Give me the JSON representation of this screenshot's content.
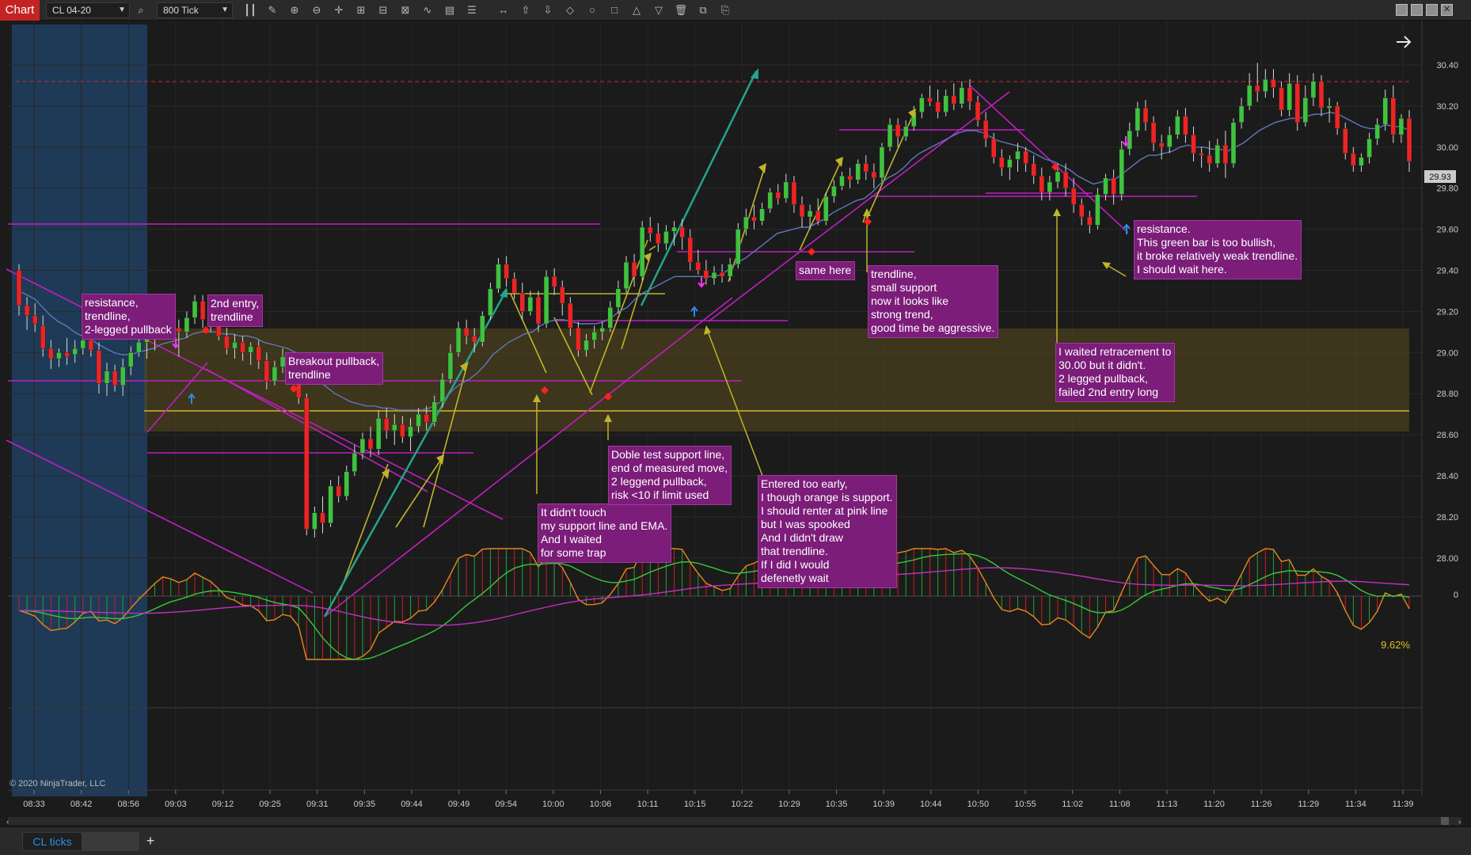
{
  "toolbar": {
    "badge": "Chart",
    "instrument": "CL 04-20",
    "interval": "800 Tick"
  },
  "tabs": {
    "active": "CL ticks",
    "add": "+"
  },
  "chart": {
    "copyright": "© 2020 NinjaTrader, LLC",
    "current_price": "29.93",
    "percent": "9.62%",
    "price_ticks": [
      "30.40",
      "30.20",
      "30.00",
      "29.80",
      "29.60",
      "29.40",
      "29.20",
      "29.00",
      "28.80",
      "28.60",
      "28.40",
      "28.20",
      "28.00"
    ],
    "osc_zero": "0",
    "time_ticks": [
      "08:33",
      "08:42",
      "08:56",
      "09:03",
      "09:12",
      "09:25",
      "09:31",
      "09:35",
      "09:44",
      "09:49",
      "09:54",
      "10:00",
      "10:06",
      "10:11",
      "10:15",
      "10:22",
      "10:29",
      "10:35",
      "10:39",
      "10:44",
      "10:50",
      "10:55",
      "11:02",
      "11:08",
      "11:13",
      "11:20",
      "11:26",
      "11:29",
      "11:34",
      "11:39"
    ]
  },
  "notes": [
    {
      "text": "resistance,\ntrendline,\n2-legged pullback"
    },
    {
      "text": "2nd entry,\ntrendline"
    },
    {
      "text": "Breakout pullback,\ntrendline"
    },
    {
      "text": "It didn't touch\nmy support line and EMA.\nAnd I waited\nfor some trap"
    },
    {
      "text": "Doble test support line,\nend of measured move,\n2 leggend pullback,\nrisk <10 if limit used"
    },
    {
      "text": "Entered too early,\nI though orange is support.\nI should renter at pink line\nbut I was spooked\nAnd I didn't draw\nthat trendline.\nIf I did I would\ndefenetly wait"
    },
    {
      "text": "same here"
    },
    {
      "text": "trendline,\nsmall support\nnow it looks like\nstrong trend,\ngood time be aggressive."
    },
    {
      "text": "I waited retracement to\n30.00 but it didn't.\n2 legged pullback,\nfailed 2nd entry long"
    },
    {
      "text": "resistance.\nThis green bar is too bullish,\nit broke relatively weak trendline.\nI should wait here."
    }
  ],
  "candles": [
    {
      "o": 29.4,
      "h": 29.43,
      "l": 29.18,
      "c": 29.23
    },
    {
      "o": 29.23,
      "h": 29.27,
      "l": 29.11,
      "c": 29.18
    },
    {
      "o": 29.18,
      "h": 29.24,
      "l": 29.1,
      "c": 29.14
    },
    {
      "o": 29.13,
      "h": 29.18,
      "l": 28.98,
      "c": 29.02
    },
    {
      "o": 29.02,
      "h": 29.06,
      "l": 28.92,
      "c": 28.97
    },
    {
      "o": 28.97,
      "h": 29.02,
      "l": 28.93,
      "c": 29.0
    },
    {
      "o": 29.0,
      "h": 29.07,
      "l": 28.94,
      "c": 28.98
    },
    {
      "o": 28.99,
      "h": 29.06,
      "l": 28.95,
      "c": 29.02
    },
    {
      "o": 29.02,
      "h": 29.1,
      "l": 28.99,
      "c": 29.06
    },
    {
      "o": 29.06,
      "h": 29.12,
      "l": 28.98,
      "c": 29.01
    },
    {
      "o": 29.01,
      "h": 29.05,
      "l": 28.8,
      "c": 28.85
    },
    {
      "o": 28.85,
      "h": 28.95,
      "l": 28.79,
      "c": 28.91
    },
    {
      "o": 28.91,
      "h": 28.94,
      "l": 28.81,
      "c": 28.84
    },
    {
      "o": 28.84,
      "h": 28.97,
      "l": 28.79,
      "c": 28.93
    },
    {
      "o": 28.93,
      "h": 29.03,
      "l": 28.89,
      "c": 29.0
    },
    {
      "o": 29.0,
      "h": 29.08,
      "l": 28.98,
      "c": 29.05
    },
    {
      "o": 29.05,
      "h": 29.12,
      "l": 28.97,
      "c": 29.09
    },
    {
      "o": 29.09,
      "h": 29.16,
      "l": 29.01,
      "c": 29.14
    },
    {
      "o": 29.14,
      "h": 29.22,
      "l": 29.1,
      "c": 29.18
    },
    {
      "o": 29.18,
      "h": 29.22,
      "l": 29.1,
      "c": 29.12
    },
    {
      "o": 29.12,
      "h": 29.16,
      "l": 28.98,
      "c": 29.1
    },
    {
      "o": 29.1,
      "h": 29.2,
      "l": 29.07,
      "c": 29.17
    },
    {
      "o": 29.17,
      "h": 29.28,
      "l": 29.14,
      "c": 29.25
    },
    {
      "o": 29.25,
      "h": 29.28,
      "l": 29.12,
      "c": 29.16
    },
    {
      "o": 29.16,
      "h": 29.22,
      "l": 29.1,
      "c": 29.14
    },
    {
      "o": 29.14,
      "h": 29.18,
      "l": 29.06,
      "c": 29.08
    },
    {
      "o": 29.08,
      "h": 29.12,
      "l": 28.99,
      "c": 29.02
    },
    {
      "o": 29.02,
      "h": 29.09,
      "l": 28.97,
      "c": 29.05
    },
    {
      "o": 29.05,
      "h": 29.08,
      "l": 28.96,
      "c": 29.0
    },
    {
      "o": 29.0,
      "h": 29.05,
      "l": 28.94,
      "c": 29.03
    },
    {
      "o": 29.03,
      "h": 29.06,
      "l": 28.92,
      "c": 28.96
    },
    {
      "o": 28.96,
      "h": 29.0,
      "l": 28.82,
      "c": 28.86
    },
    {
      "o": 28.86,
      "h": 28.96,
      "l": 28.84,
      "c": 28.93
    },
    {
      "o": 28.93,
      "h": 29.02,
      "l": 28.9,
      "c": 28.98
    },
    {
      "o": 28.98,
      "h": 29.0,
      "l": 28.87,
      "c": 28.91
    },
    {
      "o": 28.91,
      "h": 28.95,
      "l": 28.75,
      "c": 28.78
    },
    {
      "o": 28.78,
      "h": 28.8,
      "l": 28.11,
      "c": 28.14
    },
    {
      "o": 28.14,
      "h": 28.25,
      "l": 28.1,
      "c": 28.22
    },
    {
      "o": 28.22,
      "h": 28.3,
      "l": 28.12,
      "c": 28.17
    },
    {
      "o": 28.17,
      "h": 28.38,
      "l": 28.15,
      "c": 28.35
    },
    {
      "o": 28.35,
      "h": 28.4,
      "l": 28.27,
      "c": 28.3
    },
    {
      "o": 28.3,
      "h": 28.45,
      "l": 28.28,
      "c": 28.42
    },
    {
      "o": 28.42,
      "h": 28.55,
      "l": 28.4,
      "c": 28.51
    },
    {
      "o": 28.51,
      "h": 28.61,
      "l": 28.48,
      "c": 28.58
    },
    {
      "o": 28.58,
      "h": 28.64,
      "l": 28.49,
      "c": 28.53
    },
    {
      "o": 28.53,
      "h": 28.72,
      "l": 28.5,
      "c": 28.68
    },
    {
      "o": 28.68,
      "h": 28.73,
      "l": 28.58,
      "c": 28.62
    },
    {
      "o": 28.62,
      "h": 28.7,
      "l": 28.55,
      "c": 28.65
    },
    {
      "o": 28.65,
      "h": 28.69,
      "l": 28.56,
      "c": 28.59
    },
    {
      "o": 28.59,
      "h": 28.68,
      "l": 28.52,
      "c": 28.64
    },
    {
      "o": 28.64,
      "h": 28.73,
      "l": 28.61,
      "c": 28.7
    },
    {
      "o": 28.7,
      "h": 28.74,
      "l": 28.62,
      "c": 28.66
    },
    {
      "o": 28.66,
      "h": 28.79,
      "l": 28.64,
      "c": 28.76
    },
    {
      "o": 28.76,
      "h": 28.9,
      "l": 28.73,
      "c": 28.87
    },
    {
      "o": 28.87,
      "h": 29.04,
      "l": 28.85,
      "c": 29.0
    },
    {
      "o": 29.0,
      "h": 29.15,
      "l": 28.98,
      "c": 29.12
    },
    {
      "o": 29.12,
      "h": 29.16,
      "l": 29.04,
      "c": 29.08
    },
    {
      "o": 29.08,
      "h": 29.12,
      "l": 29.0,
      "c": 29.05
    },
    {
      "o": 29.05,
      "h": 29.2,
      "l": 29.03,
      "c": 29.18
    },
    {
      "o": 29.18,
      "h": 29.34,
      "l": 29.16,
      "c": 29.31
    },
    {
      "o": 29.31,
      "h": 29.46,
      "l": 29.29,
      "c": 29.43
    },
    {
      "o": 29.43,
      "h": 29.47,
      "l": 29.32,
      "c": 29.36
    },
    {
      "o": 29.36,
      "h": 29.39,
      "l": 29.26,
      "c": 29.29
    },
    {
      "o": 29.29,
      "h": 29.34,
      "l": 29.16,
      "c": 29.2
    },
    {
      "o": 29.2,
      "h": 29.3,
      "l": 29.18,
      "c": 29.27
    },
    {
      "o": 29.27,
      "h": 29.3,
      "l": 29.1,
      "c": 29.14
    },
    {
      "o": 29.14,
      "h": 29.4,
      "l": 29.12,
      "c": 29.37
    },
    {
      "o": 29.37,
      "h": 29.41,
      "l": 29.28,
      "c": 29.32
    },
    {
      "o": 29.32,
      "h": 29.35,
      "l": 29.18,
      "c": 29.24
    },
    {
      "o": 29.24,
      "h": 29.27,
      "l": 29.08,
      "c": 29.12
    },
    {
      "o": 29.12,
      "h": 29.15,
      "l": 28.98,
      "c": 29.01
    },
    {
      "o": 29.01,
      "h": 29.09,
      "l": 28.98,
      "c": 29.06
    },
    {
      "o": 29.06,
      "h": 29.13,
      "l": 29.02,
      "c": 29.1
    },
    {
      "o": 29.1,
      "h": 29.15,
      "l": 29.06,
      "c": 29.12
    },
    {
      "o": 29.12,
      "h": 29.25,
      "l": 29.1,
      "c": 29.22
    },
    {
      "o": 29.22,
      "h": 29.35,
      "l": 29.19,
      "c": 29.31
    },
    {
      "o": 29.31,
      "h": 29.47,
      "l": 29.29,
      "c": 29.44
    },
    {
      "o": 29.44,
      "h": 29.48,
      "l": 29.32,
      "c": 29.37
    },
    {
      "o": 29.37,
      "h": 29.64,
      "l": 29.35,
      "c": 29.61
    },
    {
      "o": 29.61,
      "h": 29.66,
      "l": 29.54,
      "c": 29.58
    },
    {
      "o": 29.58,
      "h": 29.63,
      "l": 29.49,
      "c": 29.53
    },
    {
      "o": 29.53,
      "h": 29.62,
      "l": 29.5,
      "c": 29.59
    },
    {
      "o": 29.59,
      "h": 29.64,
      "l": 29.52,
      "c": 29.61
    },
    {
      "o": 29.61,
      "h": 29.65,
      "l": 29.5,
      "c": 29.56
    },
    {
      "o": 29.56,
      "h": 29.6,
      "l": 29.4,
      "c": 29.44
    },
    {
      "o": 29.44,
      "h": 29.5,
      "l": 29.38,
      "c": 29.4
    },
    {
      "o": 29.4,
      "h": 29.45,
      "l": 29.33,
      "c": 29.36
    },
    {
      "o": 29.36,
      "h": 29.42,
      "l": 29.33,
      "c": 29.39
    },
    {
      "o": 29.39,
      "h": 29.43,
      "l": 29.34,
      "c": 29.37
    },
    {
      "o": 29.37,
      "h": 29.46,
      "l": 29.35,
      "c": 29.43
    },
    {
      "o": 29.43,
      "h": 29.63,
      "l": 29.41,
      "c": 29.6
    },
    {
      "o": 29.6,
      "h": 29.7,
      "l": 29.57,
      "c": 29.66
    },
    {
      "o": 29.66,
      "h": 29.72,
      "l": 29.6,
      "c": 29.64
    },
    {
      "o": 29.64,
      "h": 29.73,
      "l": 29.62,
      "c": 29.7
    },
    {
      "o": 29.7,
      "h": 29.8,
      "l": 29.68,
      "c": 29.78
    },
    {
      "o": 29.78,
      "h": 29.82,
      "l": 29.72,
      "c": 29.75
    },
    {
      "o": 29.75,
      "h": 29.87,
      "l": 29.73,
      "c": 29.83
    },
    {
      "o": 29.83,
      "h": 29.86,
      "l": 29.68,
      "c": 29.72
    },
    {
      "o": 29.72,
      "h": 29.76,
      "l": 29.61,
      "c": 29.66
    },
    {
      "o": 29.66,
      "h": 29.72,
      "l": 29.6,
      "c": 29.69
    },
    {
      "o": 29.69,
      "h": 29.75,
      "l": 29.62,
      "c": 29.64
    },
    {
      "o": 29.64,
      "h": 29.78,
      "l": 29.62,
      "c": 29.76
    },
    {
      "o": 29.76,
      "h": 29.84,
      "l": 29.73,
      "c": 29.81
    },
    {
      "o": 29.81,
      "h": 29.88,
      "l": 29.79,
      "c": 29.86
    },
    {
      "o": 29.86,
      "h": 29.9,
      "l": 29.8,
      "c": 29.84
    },
    {
      "o": 29.84,
      "h": 29.94,
      "l": 29.82,
      "c": 29.92
    },
    {
      "o": 29.92,
      "h": 29.96,
      "l": 29.84,
      "c": 29.88
    },
    {
      "o": 29.88,
      "h": 29.92,
      "l": 29.8,
      "c": 29.85
    },
    {
      "o": 29.85,
      "h": 30.02,
      "l": 29.83,
      "c": 30.0
    },
    {
      "o": 30.0,
      "h": 30.14,
      "l": 29.98,
      "c": 30.11
    },
    {
      "o": 30.11,
      "h": 30.14,
      "l": 30.0,
      "c": 30.05
    },
    {
      "o": 30.05,
      "h": 30.13,
      "l": 30.03,
      "c": 30.1
    },
    {
      "o": 30.1,
      "h": 30.2,
      "l": 30.08,
      "c": 30.17
    },
    {
      "o": 30.17,
      "h": 30.26,
      "l": 30.14,
      "c": 30.24
    },
    {
      "o": 30.24,
      "h": 30.3,
      "l": 30.2,
      "c": 30.22
    },
    {
      "o": 30.22,
      "h": 30.28,
      "l": 30.14,
      "c": 30.17
    },
    {
      "o": 30.17,
      "h": 30.28,
      "l": 30.15,
      "c": 30.25
    },
    {
      "o": 30.25,
      "h": 30.31,
      "l": 30.18,
      "c": 30.21
    },
    {
      "o": 30.21,
      "h": 30.32,
      "l": 30.19,
      "c": 30.29
    },
    {
      "o": 30.29,
      "h": 30.33,
      "l": 30.18,
      "c": 30.22
    },
    {
      "o": 30.22,
      "h": 30.25,
      "l": 30.1,
      "c": 30.13
    },
    {
      "o": 30.13,
      "h": 30.17,
      "l": 30.0,
      "c": 30.04
    },
    {
      "o": 30.04,
      "h": 30.07,
      "l": 29.92,
      "c": 29.95
    },
    {
      "o": 29.95,
      "h": 29.99,
      "l": 29.86,
      "c": 29.9
    },
    {
      "o": 29.9,
      "h": 29.96,
      "l": 29.84,
      "c": 29.94
    },
    {
      "o": 29.94,
      "h": 30.02,
      "l": 29.88,
      "c": 29.98
    },
    {
      "o": 29.98,
      "h": 30.0,
      "l": 29.88,
      "c": 29.92
    },
    {
      "o": 29.92,
      "h": 29.96,
      "l": 29.82,
      "c": 29.86
    },
    {
      "o": 29.86,
      "h": 29.9,
      "l": 29.74,
      "c": 29.78
    },
    {
      "o": 29.78,
      "h": 29.86,
      "l": 29.74,
      "c": 29.83
    },
    {
      "o": 29.83,
      "h": 29.92,
      "l": 29.8,
      "c": 29.88
    },
    {
      "o": 29.88,
      "h": 29.92,
      "l": 29.76,
      "c": 29.8
    },
    {
      "o": 29.8,
      "h": 29.85,
      "l": 29.68,
      "c": 29.72
    },
    {
      "o": 29.72,
      "h": 29.75,
      "l": 29.62,
      "c": 29.66
    },
    {
      "o": 29.66,
      "h": 29.69,
      "l": 29.58,
      "c": 29.62
    },
    {
      "o": 29.62,
      "h": 29.8,
      "l": 29.6,
      "c": 29.77
    },
    {
      "o": 29.77,
      "h": 29.87,
      "l": 29.74,
      "c": 29.85
    },
    {
      "o": 29.85,
      "h": 29.89,
      "l": 29.72,
      "c": 29.77
    },
    {
      "o": 29.77,
      "h": 30.03,
      "l": 29.74,
      "c": 29.99
    },
    {
      "o": 29.99,
      "h": 30.12,
      "l": 29.96,
      "c": 30.08
    },
    {
      "o": 30.08,
      "h": 30.22,
      "l": 30.05,
      "c": 30.19
    },
    {
      "o": 30.19,
      "h": 30.23,
      "l": 30.08,
      "c": 30.12
    },
    {
      "o": 30.12,
      "h": 30.15,
      "l": 29.98,
      "c": 30.02
    },
    {
      "o": 30.02,
      "h": 30.06,
      "l": 29.94,
      "c": 30.0
    },
    {
      "o": 30.0,
      "h": 30.1,
      "l": 29.97,
      "c": 30.06
    },
    {
      "o": 30.06,
      "h": 30.18,
      "l": 30.04,
      "c": 30.15
    },
    {
      "o": 30.15,
      "h": 30.19,
      "l": 30.02,
      "c": 30.06
    },
    {
      "o": 30.06,
      "h": 30.1,
      "l": 29.93,
      "c": 29.97
    },
    {
      "o": 29.97,
      "h": 30.0,
      "l": 29.9,
      "c": 29.96
    },
    {
      "o": 29.96,
      "h": 30.03,
      "l": 29.88,
      "c": 29.92
    },
    {
      "o": 29.92,
      "h": 30.04,
      "l": 29.9,
      "c": 30.01
    },
    {
      "o": 30.01,
      "h": 30.08,
      "l": 29.85,
      "c": 29.92
    },
    {
      "o": 29.92,
      "h": 30.14,
      "l": 29.9,
      "c": 30.12
    },
    {
      "o": 30.12,
      "h": 30.24,
      "l": 30.09,
      "c": 30.2
    },
    {
      "o": 30.2,
      "h": 30.36,
      "l": 30.18,
      "c": 30.3
    },
    {
      "o": 30.3,
      "h": 30.41,
      "l": 30.22,
      "c": 30.27
    },
    {
      "o": 30.27,
      "h": 30.38,
      "l": 30.24,
      "c": 30.33
    },
    {
      "o": 30.33,
      "h": 30.38,
      "l": 30.24,
      "c": 30.29
    },
    {
      "o": 30.29,
      "h": 30.32,
      "l": 30.15,
      "c": 30.18
    },
    {
      "o": 30.18,
      "h": 30.36,
      "l": 30.15,
      "c": 30.31
    },
    {
      "o": 30.31,
      "h": 30.35,
      "l": 30.08,
      "c": 30.12
    },
    {
      "o": 30.12,
      "h": 30.3,
      "l": 30.1,
      "c": 30.24
    },
    {
      "o": 30.24,
      "h": 30.36,
      "l": 30.2,
      "c": 30.32
    },
    {
      "o": 30.32,
      "h": 30.35,
      "l": 30.15,
      "c": 30.19
    },
    {
      "o": 30.19,
      "h": 30.24,
      "l": 30.12,
      "c": 30.2
    },
    {
      "o": 30.2,
      "h": 30.22,
      "l": 30.06,
      "c": 30.09
    },
    {
      "o": 30.09,
      "h": 30.12,
      "l": 29.94,
      "c": 29.97
    },
    {
      "o": 29.97,
      "h": 30.0,
      "l": 29.88,
      "c": 29.91
    },
    {
      "o": 29.91,
      "h": 29.97,
      "l": 29.88,
      "c": 29.95
    },
    {
      "o": 29.95,
      "h": 30.07,
      "l": 29.92,
      "c": 30.04
    },
    {
      "o": 30.04,
      "h": 30.14,
      "l": 30.01,
      "c": 30.11
    },
    {
      "o": 30.11,
      "h": 30.28,
      "l": 30.08,
      "c": 30.24
    },
    {
      "o": 30.24,
      "h": 30.3,
      "l": 30.02,
      "c": 30.06
    },
    {
      "o": 30.06,
      "h": 30.16,
      "l": 30.02,
      "c": 30.14
    },
    {
      "o": 30.14,
      "h": 30.18,
      "l": 29.88,
      "c": 29.93
    }
  ],
  "ema": [
    29.3,
    29.28,
    29.26,
    29.22,
    29.18,
    29.15,
    29.13,
    29.1,
    29.08,
    29.07,
    29.04,
    29.02,
    29.0,
    28.99,
    28.99,
    29.0,
    29.01,
    29.02,
    29.04,
    29.05,
    29.06,
    29.07,
    29.09,
    29.1,
    29.1,
    29.1,
    29.09,
    29.09,
    29.08,
    29.08,
    29.07,
    29.05,
    29.04,
    29.03,
    29.02,
    29.0,
    28.95,
    28.9,
    28.86,
    28.83,
    28.8,
    28.78,
    28.76,
    28.75,
    28.74,
    28.74,
    28.73,
    28.73,
    28.72,
    28.72,
    28.72,
    28.72,
    28.73,
    28.75,
    28.78,
    28.82,
    28.85,
    28.87,
    28.9,
    28.94,
    28.99,
    29.02,
    29.05,
    29.07,
    29.09,
    29.1,
    29.13,
    29.15,
    29.16,
    29.16,
    29.15,
    29.14,
    29.14,
    29.14,
    29.15,
    29.17,
    29.2,
    29.22,
    29.26,
    29.29,
    29.31,
    29.33,
    29.35,
    29.37,
    29.37,
    29.37,
    29.37,
    29.37,
    29.37,
    29.38,
    29.41,
    29.44,
    29.46,
    29.49,
    29.52,
    29.55,
    29.58,
    29.59,
    29.6,
    29.61,
    29.61,
    29.63,
    29.65,
    29.68,
    29.7,
    29.72,
    29.74,
    29.75,
    29.78,
    29.82,
    29.85,
    29.87,
    29.9,
    29.94,
    29.97,
    29.99,
    30.01,
    30.03,
    30.05,
    30.07,
    30.08,
    30.08,
    30.07,
    30.05,
    30.03,
    30.02,
    30.01,
    30.0,
    29.98,
    29.96,
    29.94,
    29.93,
    29.91,
    29.89,
    29.86,
    29.84,
    29.82,
    29.83,
    29.84,
    29.85,
    29.88,
    29.91,
    29.94,
    29.96,
    29.96,
    29.97,
    29.98,
    30.0,
    30.01,
    30.0,
    30.0,
    29.99,
    29.99,
    29.98,
    30.0,
    30.02,
    30.05,
    30.08,
    30.1,
    30.12,
    30.13,
    30.14,
    30.14,
    30.15,
    30.16,
    30.16,
    30.17,
    30.16,
    30.14,
    30.12,
    30.1,
    30.09,
    30.09,
    30.11,
    30.1,
    30.1,
    30.08
  ]
}
